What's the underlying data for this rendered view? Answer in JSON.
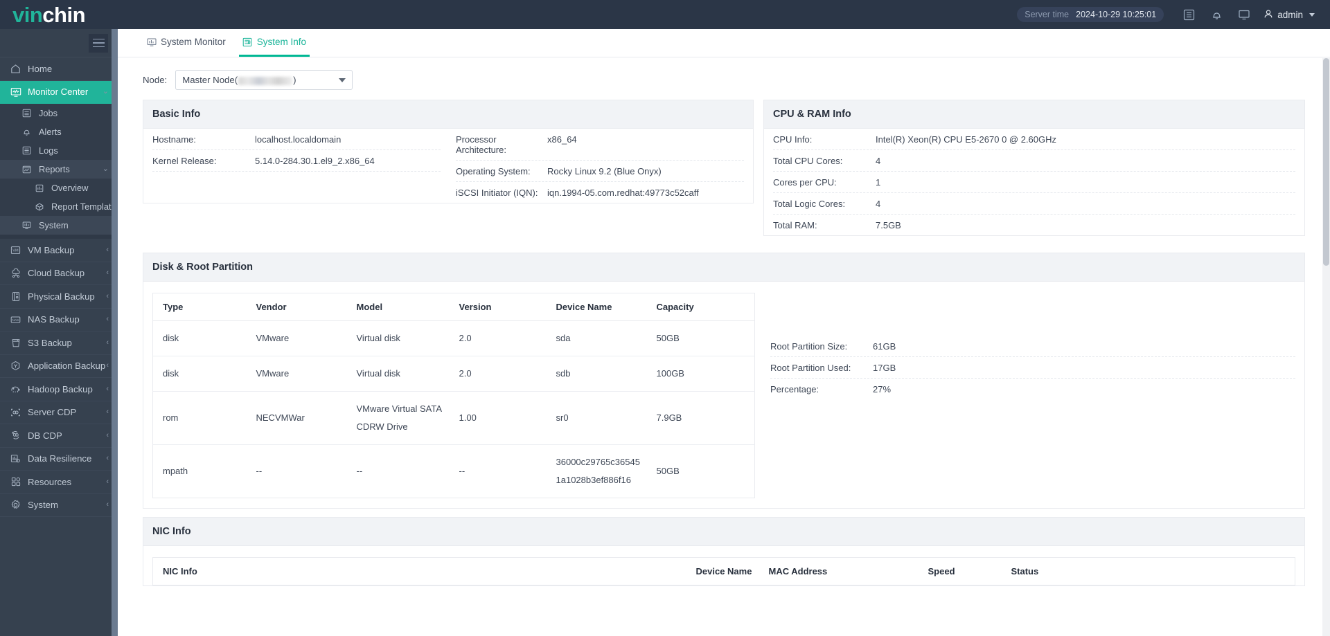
{
  "brand": {
    "part1": "vin",
    "part2": "chin"
  },
  "topbar": {
    "server_time_label": "Server time",
    "server_time_value": "2024-10-29 10:25:01",
    "icons": [
      "list-icon",
      "bell-icon",
      "monitor-icon"
    ],
    "user": "admin"
  },
  "sidebar": {
    "items": [
      {
        "label": "Home",
        "icon": "home-icon",
        "type": "top"
      },
      {
        "label": "Monitor Center",
        "icon": "monitor-center-icon",
        "type": "top",
        "active": true,
        "chev": "v"
      },
      {
        "label": "Jobs",
        "icon": "jobs-icon",
        "type": "sub"
      },
      {
        "label": "Alerts",
        "icon": "alerts-icon",
        "type": "sub"
      },
      {
        "label": "Logs",
        "icon": "logs-icon",
        "type": "sub"
      },
      {
        "label": "Reports",
        "icon": "reports-icon",
        "type": "sub-group",
        "chev": "v"
      },
      {
        "label": "Overview",
        "icon": "overview-icon",
        "type": "sub2"
      },
      {
        "label": "Report Template",
        "icon": "report-template-icon",
        "type": "sub2"
      },
      {
        "label": "System",
        "icon": "system-monitor-icon",
        "type": "sub-sel"
      },
      {
        "label": "VM Backup",
        "icon": "vm-icon",
        "type": "top",
        "chev": "<"
      },
      {
        "label": "Cloud Backup",
        "icon": "cloud-icon",
        "type": "top",
        "chev": "<"
      },
      {
        "label": "Physical Backup",
        "icon": "server-icon",
        "type": "top",
        "chev": "<"
      },
      {
        "label": "NAS Backup",
        "icon": "nas-icon",
        "type": "top",
        "chev": "<"
      },
      {
        "label": "S3 Backup",
        "icon": "bucket-icon",
        "type": "top",
        "chev": "<"
      },
      {
        "label": "Application Backup",
        "icon": "app-icon",
        "type": "top",
        "chev": "<"
      },
      {
        "label": "Hadoop Backup",
        "icon": "hadoop-icon",
        "type": "top",
        "chev": "<"
      },
      {
        "label": "Server CDP",
        "icon": "server-cdp-icon",
        "type": "top",
        "chev": "<"
      },
      {
        "label": "DB CDP",
        "icon": "db-cdp-icon",
        "type": "top",
        "chev": "<"
      },
      {
        "label": "Data Resilience",
        "icon": "data-resilience-icon",
        "type": "top",
        "chev": "<"
      },
      {
        "label": "Resources",
        "icon": "resources-icon",
        "type": "top",
        "chev": "<"
      },
      {
        "label": "System",
        "icon": "gear-icon",
        "type": "top",
        "chev": "<"
      }
    ]
  },
  "tabs": [
    {
      "label": "System Monitor",
      "icon": "monitor-icon",
      "active": false
    },
    {
      "label": "System Info",
      "icon": "info-doc-icon",
      "active": true
    }
  ],
  "node": {
    "label": "Node:",
    "value_prefix": "Master Node(",
    "value_suffix": ")"
  },
  "basic_info": {
    "title": "Basic Info",
    "left": [
      {
        "k": "Hostname:",
        "v": "localhost.localdomain"
      },
      {
        "k": "Kernel Release:",
        "v": "5.14.0-284.30.1.el9_2.x86_64"
      }
    ],
    "right": [
      {
        "k": "Processor Architecture:",
        "v": "x86_64"
      },
      {
        "k": "Operating System:",
        "v": "Rocky Linux 9.2 (Blue Onyx)"
      },
      {
        "k": "iSCSI Initiator (IQN):",
        "v": "iqn.1994-05.com.redhat:49773c52caff"
      }
    ]
  },
  "cpu_ram_info": {
    "title": "CPU & RAM Info",
    "rows": [
      {
        "k": "CPU Info:",
        "v": "Intel(R) Xeon(R) CPU E5-2670 0 @ 2.60GHz"
      },
      {
        "k": "Total CPU Cores:",
        "v": "4"
      },
      {
        "k": "Cores per CPU:",
        "v": "1"
      },
      {
        "k": "Total Logic Cores:",
        "v": "4"
      },
      {
        "k": "Total RAM:",
        "v": "7.5GB"
      }
    ]
  },
  "disk_section": {
    "title": "Disk & Root Partition",
    "columns": [
      "Type",
      "Vendor",
      "Model",
      "Version",
      "Device Name",
      "Capacity"
    ],
    "rows": [
      {
        "type": "disk",
        "vendor": "VMware",
        "model": "Virtual disk",
        "version": "2.0",
        "device": "sda",
        "capacity": "50GB"
      },
      {
        "type": "disk",
        "vendor": "VMware",
        "model": "Virtual disk",
        "version": "2.0",
        "device": "sdb",
        "capacity": "100GB"
      },
      {
        "type": "rom",
        "vendor": "NECVMWar",
        "model": "VMware Virtual SATA CDRW Drive",
        "version": "1.00",
        "device": "sr0",
        "capacity": "7.9GB"
      },
      {
        "type": "mpath",
        "vendor": "--",
        "model": "--",
        "version": "--",
        "device": "36000c29765c36545 1a1028b3ef886f16",
        "capacity": "50GB"
      }
    ],
    "partition": [
      {
        "k": "Root Partition Size:",
        "v": "61GB"
      },
      {
        "k": "Root Partition Used:",
        "v": "17GB"
      },
      {
        "k": "Percentage:",
        "v": "27%"
      }
    ]
  },
  "nic_section": {
    "title": "NIC Info",
    "columns": [
      "NIC Info",
      "Device Name",
      "MAC Address",
      "Speed",
      "Status"
    ]
  },
  "colors": {
    "accent": "#21b49a",
    "sidebar": "#36414f",
    "topbar": "#2b3647",
    "tab_active": "#16b397"
  }
}
